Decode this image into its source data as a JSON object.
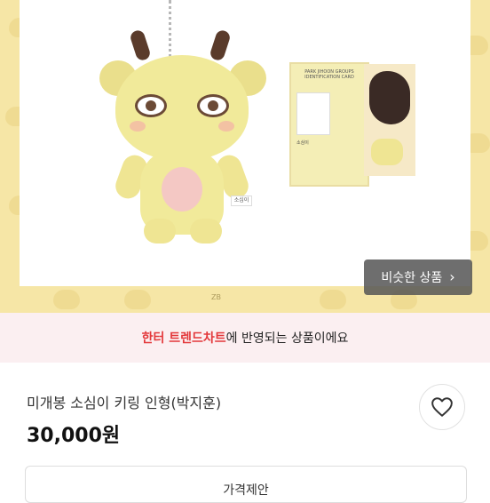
{
  "hero": {
    "similar_button_label": "비슷한 상품",
    "chevron_icon": "chevron-right-icon",
    "card_header": "PARK JIHOON GROUPS IDENTIFICATION CARD",
    "card_name": "소심이",
    "tag_text": "소심이",
    "brand_text": "ZB",
    "background_color": "#f6e6a6"
  },
  "banner": {
    "accent_text": "한터 트렌드차트",
    "rest_text": "에 반영되는 상품이에요"
  },
  "product": {
    "title": "미개봉 소심이 키링 인형(박지훈)",
    "price": "30,000원",
    "like_icon": "heart-icon",
    "offer_button_label": "가격제안"
  }
}
